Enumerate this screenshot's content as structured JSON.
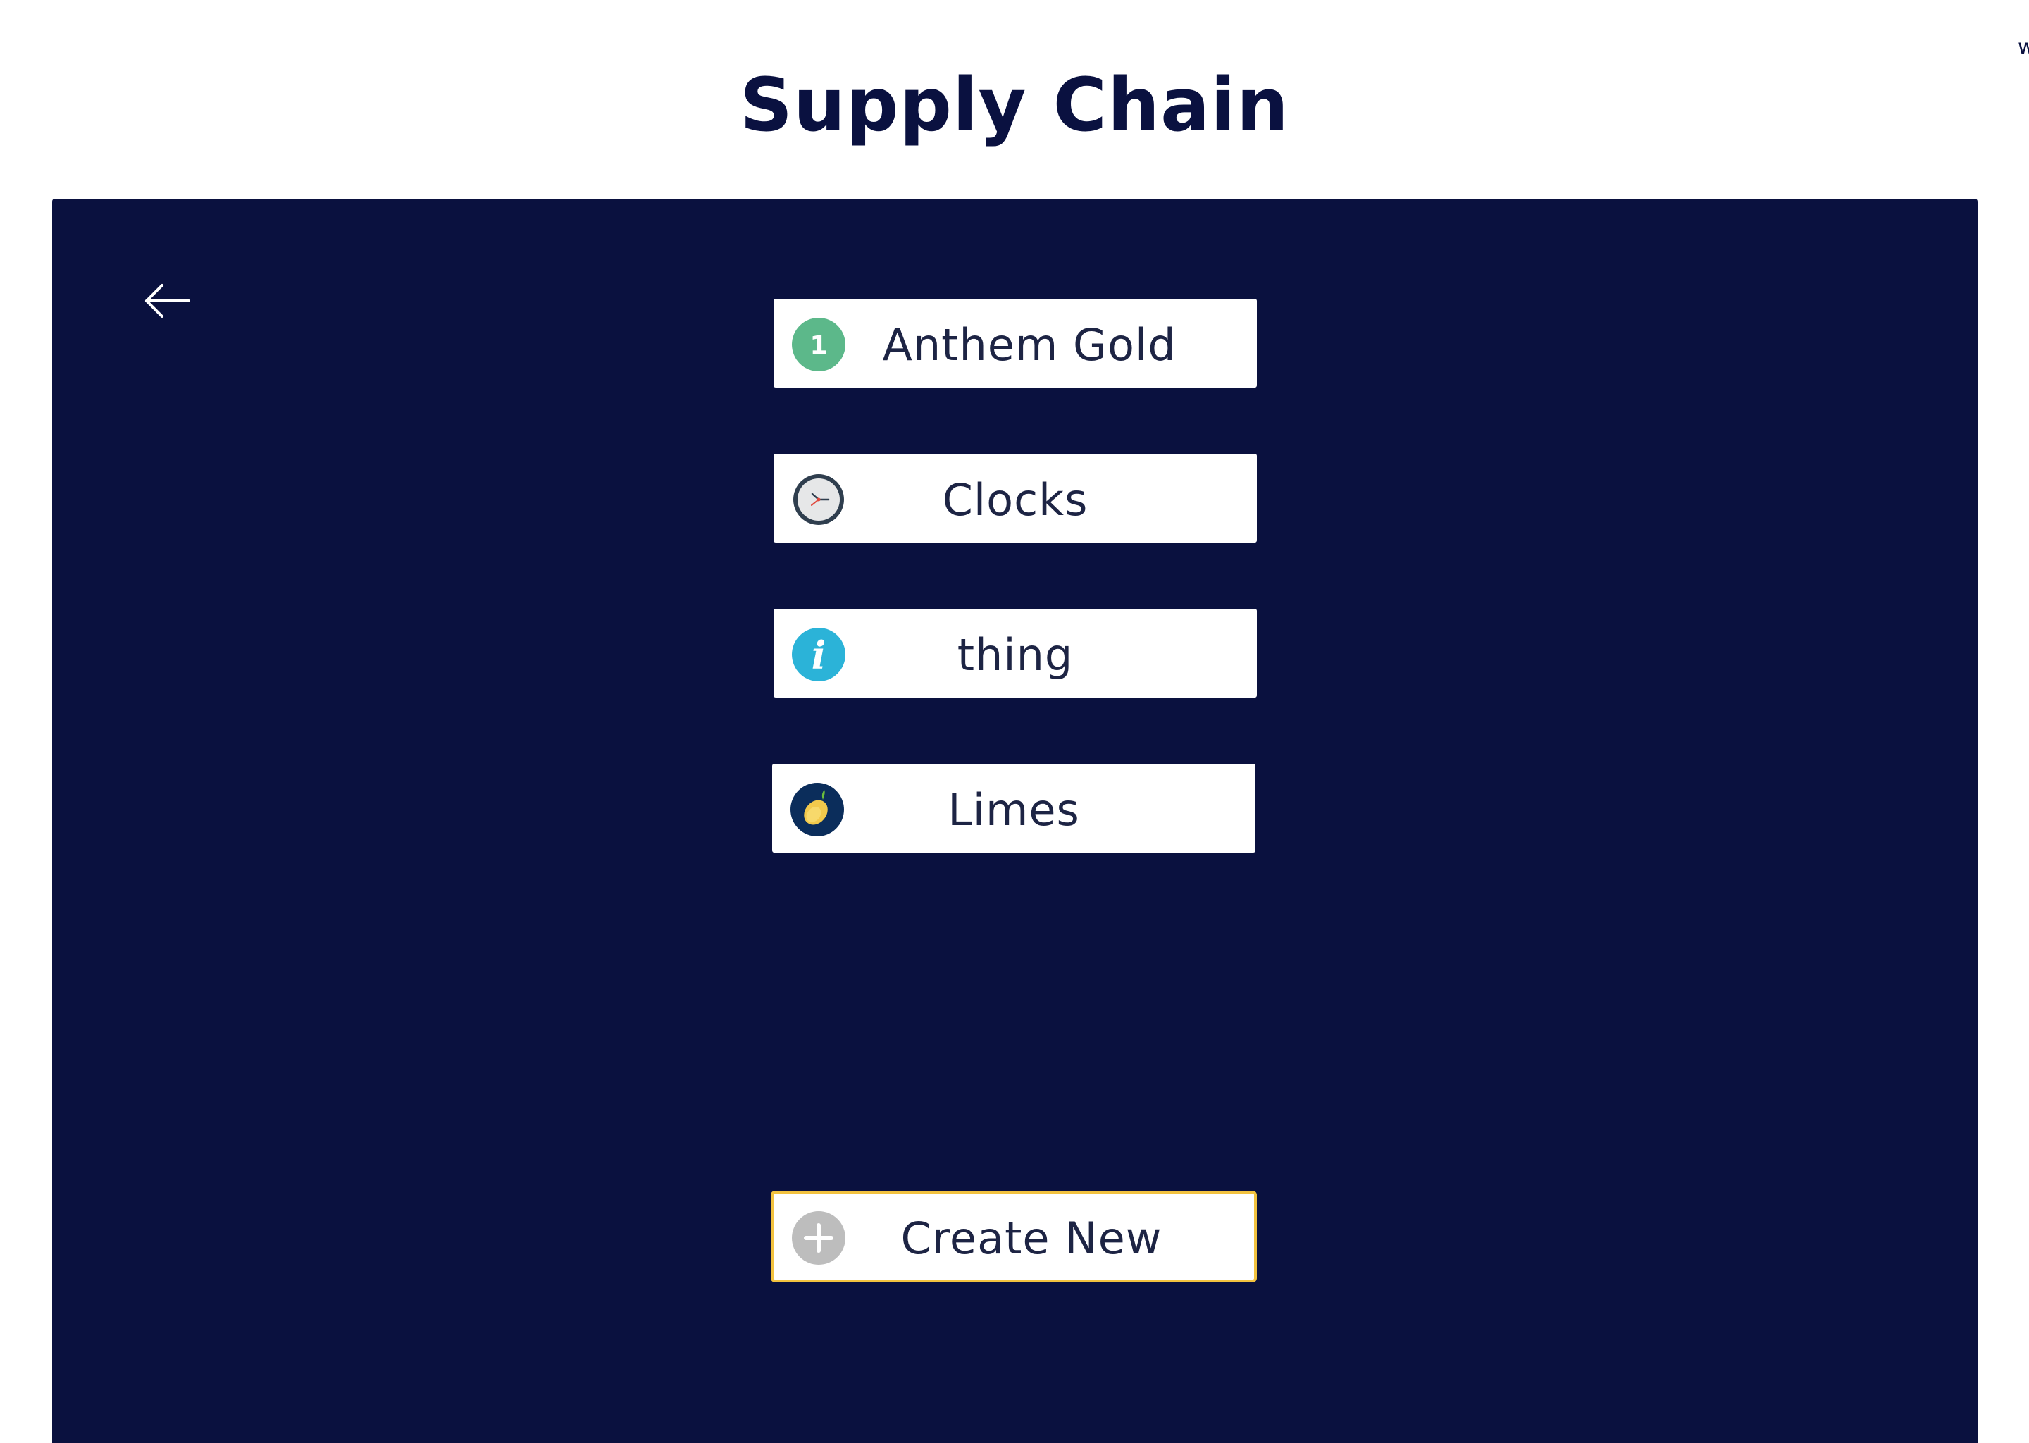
{
  "corner_text": "w",
  "page_title": "Supply Chain",
  "panel": {
    "background": "#0a113f",
    "back_icon": "arrow-left-icon"
  },
  "items": [
    {
      "label": "Anthem Gold",
      "icon": "number-one-icon",
      "icon_color": "#5cb88a"
    },
    {
      "label": "Clocks",
      "icon": "clock-icon",
      "icon_color": "#2f3e4e"
    },
    {
      "label": "thing",
      "icon": "info-icon",
      "icon_color": "#2bb3d8"
    },
    {
      "label": "Limes",
      "icon": "lemon-icon",
      "icon_color": "#0b2d5b"
    }
  ],
  "create_button": {
    "label": "Create New",
    "icon": "plus-icon",
    "icon_color": "#bdbdbd",
    "border_color": "#f2c23f"
  }
}
